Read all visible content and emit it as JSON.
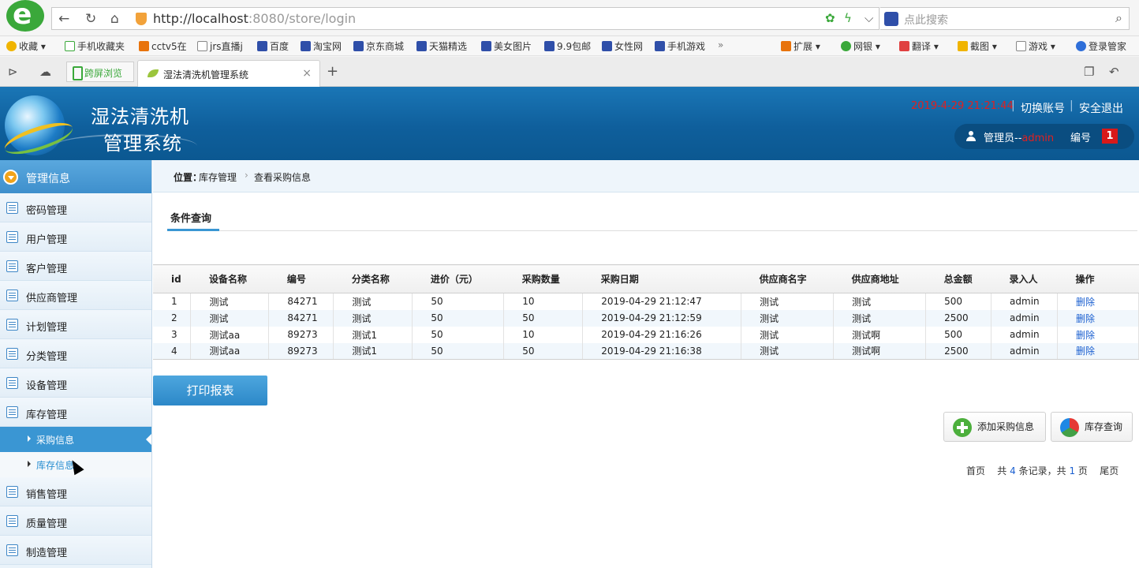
{
  "browser": {
    "url_host": "http://localhost",
    "url_rest": ":8080/store/login",
    "search_placeholder": "点此搜索",
    "bookmarks": [
      {
        "label": "收藏",
        "icon": "star-icon"
      },
      {
        "label": "手机收藏夹",
        "icon": "phone-icon"
      },
      {
        "label": "cctv5在",
        "icon": "grid-icon"
      },
      {
        "label": "jrs直播j",
        "icon": "doc-icon"
      },
      {
        "label": "百度",
        "icon": "paw-icon"
      },
      {
        "label": "淘宝网",
        "icon": "paw-icon"
      },
      {
        "label": "京东商城",
        "icon": "paw-icon"
      },
      {
        "label": "天猫精选",
        "icon": "paw-icon"
      },
      {
        "label": "美女图片",
        "icon": "paw-icon"
      },
      {
        "label": "9.9包邮",
        "icon": "paw-icon"
      },
      {
        "label": "女性网",
        "icon": "paw-icon"
      },
      {
        "label": "手机游戏",
        "icon": "paw-icon"
      }
    ],
    "more": "»",
    "tools": [
      "扩展",
      "网银",
      "翻译",
      "截图",
      "游戏",
      "登录管家"
    ],
    "tab_pinned": "跨屏浏览",
    "tab_active": "湿法清洗机管理系统"
  },
  "header": {
    "title_line1": "湿法清洗机",
    "title_line2": "管理系统",
    "datetime": "2019-4-29 21:21:44",
    "switch_account": "切换账号",
    "logout": "安全退出",
    "user_prefix": "管理员--",
    "user_name": "admin",
    "number_label": "编号",
    "number_value": "1"
  },
  "sidebar": {
    "top": "管理信息",
    "items": [
      "密码管理",
      "用户管理",
      "客户管理",
      "供应商管理",
      "计划管理",
      "分类管理",
      "设备管理",
      "库存管理"
    ],
    "sub_items": [
      "采购信息",
      "库存信息"
    ],
    "items_after": [
      "销售管理",
      "质量管理",
      "制造管理"
    ]
  },
  "breadcrumb": {
    "label": "位置：",
    "level1": "库存管理",
    "sep": "›",
    "level2": "查看采购信息"
  },
  "query_tab": "条件查询",
  "table": {
    "headers": [
      "id",
      "设备名称",
      "编号",
      "分类名称",
      "进价（元）",
      "采购数量",
      "采购日期",
      "供应商名字",
      "供应商地址",
      "总金额",
      "录入人",
      "操作"
    ],
    "rows": [
      [
        "1",
        "测试",
        "84271",
        "测试",
        "50",
        "10",
        "2019-04-29 21:12:47",
        "测试",
        "测试",
        "500",
        "admin",
        "删除"
      ],
      [
        "2",
        "测试",
        "84271",
        "测试",
        "50",
        "50",
        "2019-04-29 21:12:59",
        "测试",
        "测试",
        "2500",
        "admin",
        "删除"
      ],
      [
        "3",
        "测试aa",
        "89273",
        "测试1",
        "50",
        "10",
        "2019-04-29 21:16:26",
        "测试",
        "测试啊",
        "500",
        "admin",
        "删除"
      ],
      [
        "4",
        "测试aa",
        "89273",
        "测试1",
        "50",
        "50",
        "2019-04-29 21:16:38",
        "测试",
        "测试啊",
        "2500",
        "admin",
        "删除"
      ]
    ]
  },
  "buttons": {
    "print": "打印报表",
    "add_purchase": "添加采购信息",
    "stock_query": "库存查询"
  },
  "pager": {
    "first": "首页",
    "total_prefix": "共",
    "total_records": "4",
    "records_suffix": "条记录，共",
    "total_pages": "1",
    "pages_suffix": "页",
    "last": "尾页"
  },
  "colors": {
    "header_blue": "#0f5f9c",
    "sidebar_active": "#3a96d3",
    "link_blue": "#1a5fd0",
    "alert_red": "#e02020"
  }
}
